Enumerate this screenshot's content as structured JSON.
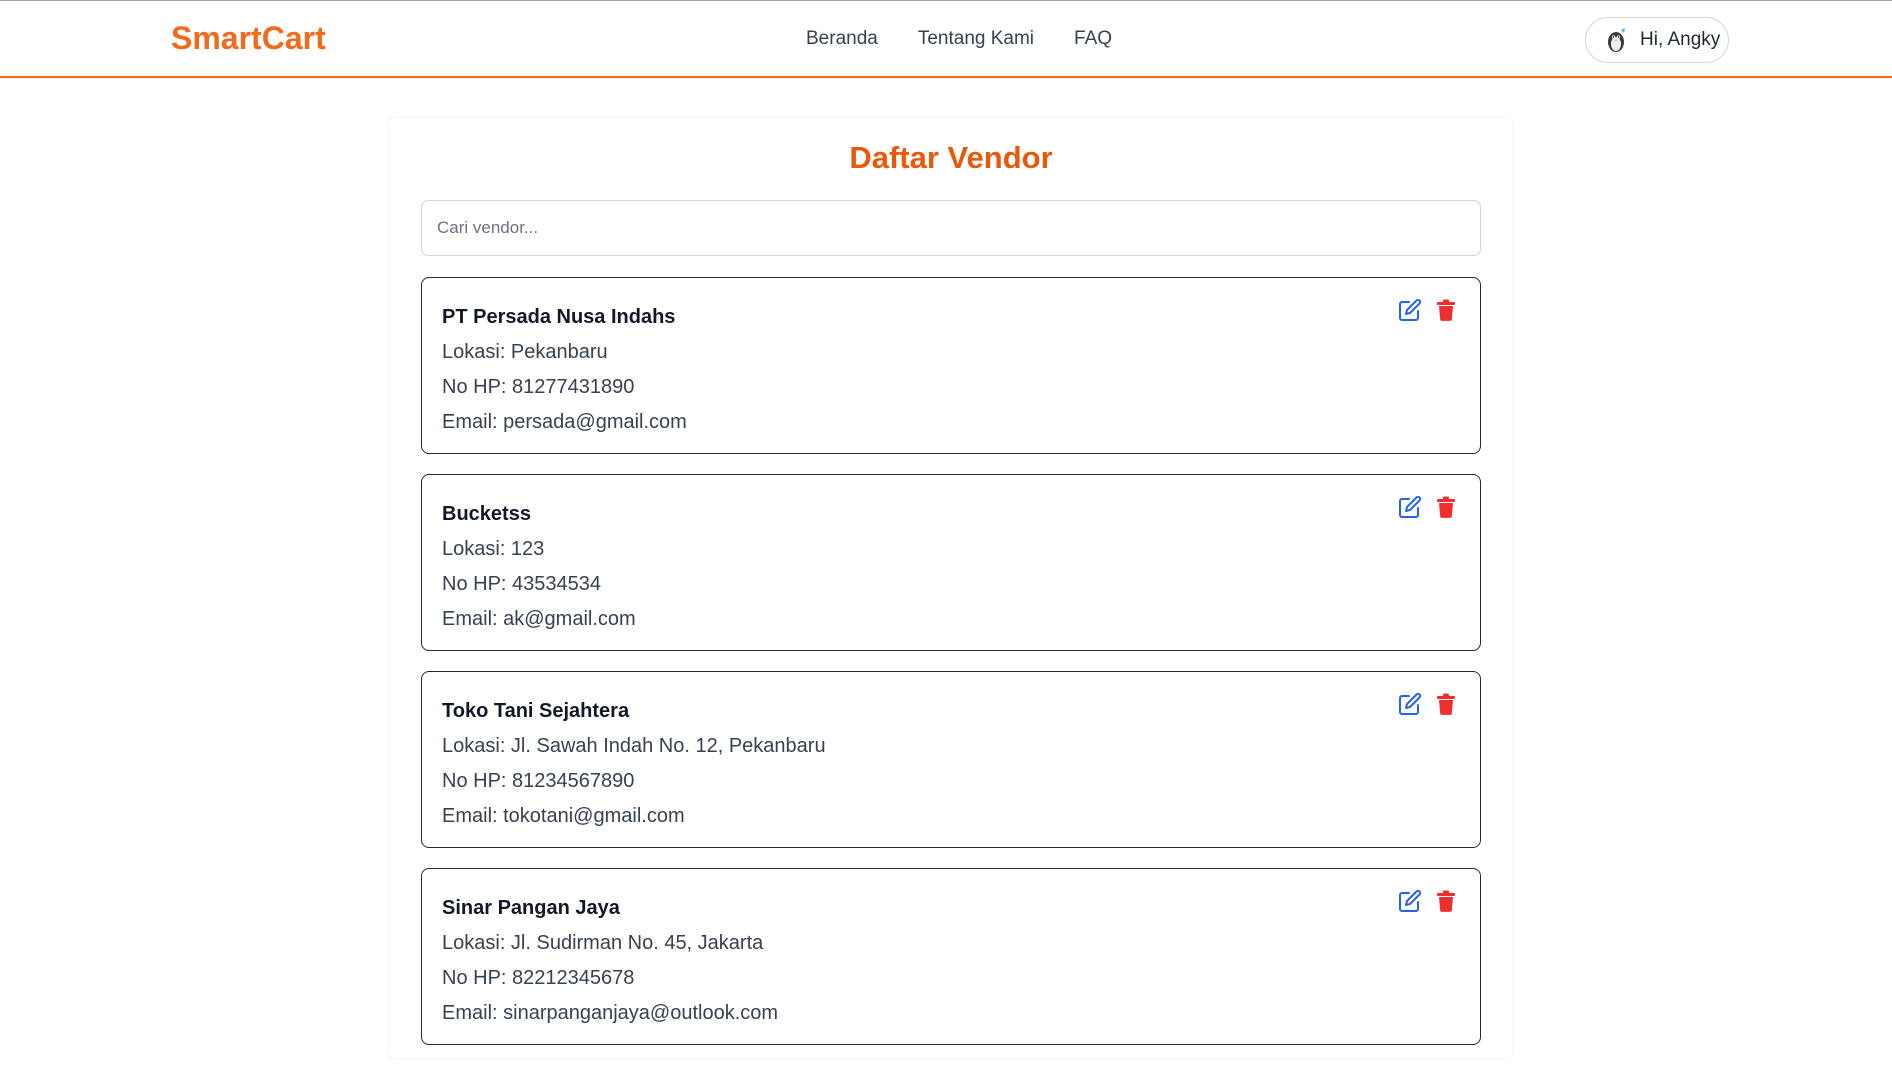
{
  "brand": "SmartCart",
  "nav": {
    "items": [
      "Beranda",
      "Tentang Kami",
      "FAQ"
    ]
  },
  "user": {
    "greeting": "Hi, Angky",
    "avatar_icon": "avatar-icon"
  },
  "page": {
    "title": "Daftar Vendor",
    "search_placeholder": "Cari vendor..."
  },
  "colors": {
    "accent": "#f26a1b",
    "title": "#ea580c",
    "edit_icon": "#2563eb",
    "delete_icon": "#ef2f2f"
  },
  "vendors": [
    {
      "name": "PT Persada Nusa Indahs",
      "lokasi": "Lokasi: Pekanbaru",
      "no_hp": "No HP: 81277431890",
      "email": "Email: persada@gmail.com"
    },
    {
      "name": "Bucketss",
      "lokasi": "Lokasi: 123",
      "no_hp": "No HP: 43534534",
      "email": "Email: ak@gmail.com"
    },
    {
      "name": "Toko Tani Sejahtera",
      "lokasi": "Lokasi: Jl. Sawah Indah No. 12, Pekanbaru",
      "no_hp": "No HP: 81234567890",
      "email": "Email: tokotani@gmail.com"
    },
    {
      "name": "Sinar Pangan Jaya",
      "lokasi": "Lokasi: Jl. Sudirman No. 45, Jakarta",
      "no_hp": "No HP: 82212345678",
      "email": "Email: sinarpanganjaya@outlook.com"
    }
  ]
}
